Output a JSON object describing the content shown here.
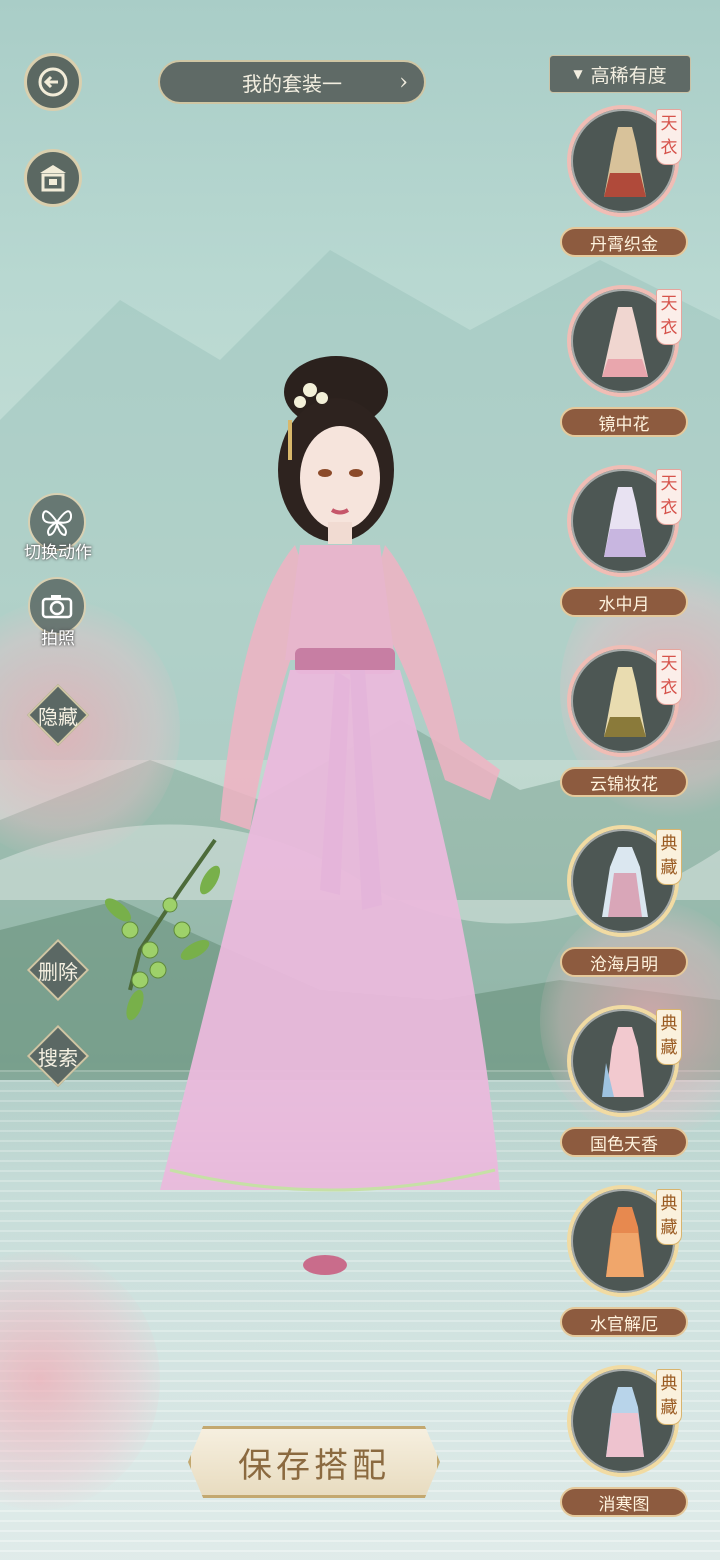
{
  "header": {
    "outfit_title": "我的套装一",
    "sort_label": "高稀有度"
  },
  "sidebar": {
    "switch_pose": "切换动作",
    "photo": "拍照",
    "hide": "隐藏",
    "delete": "删除",
    "search": "搜索"
  },
  "items": [
    {
      "name": "丹霄织金",
      "tier": "天衣"
    },
    {
      "name": "镜中花",
      "tier": "天衣"
    },
    {
      "name": "水中月",
      "tier": "天衣"
    },
    {
      "name": "云锦妆花",
      "tier": "天衣"
    },
    {
      "name": "沧海月明",
      "tier": "典藏"
    },
    {
      "name": "国色天香",
      "tier": "典藏"
    },
    {
      "name": "水官解厄",
      "tier": "典藏"
    },
    {
      "name": "消寒图",
      "tier": "典藏"
    }
  ],
  "footer": {
    "save_label": "保存搭配"
  },
  "colors": {
    "button_dark": "#5f6a66",
    "tian_yi_badge": "#d6534b",
    "dian_cang_badge": "#9a5b22",
    "item_name_bg": "#8d5b3f"
  }
}
